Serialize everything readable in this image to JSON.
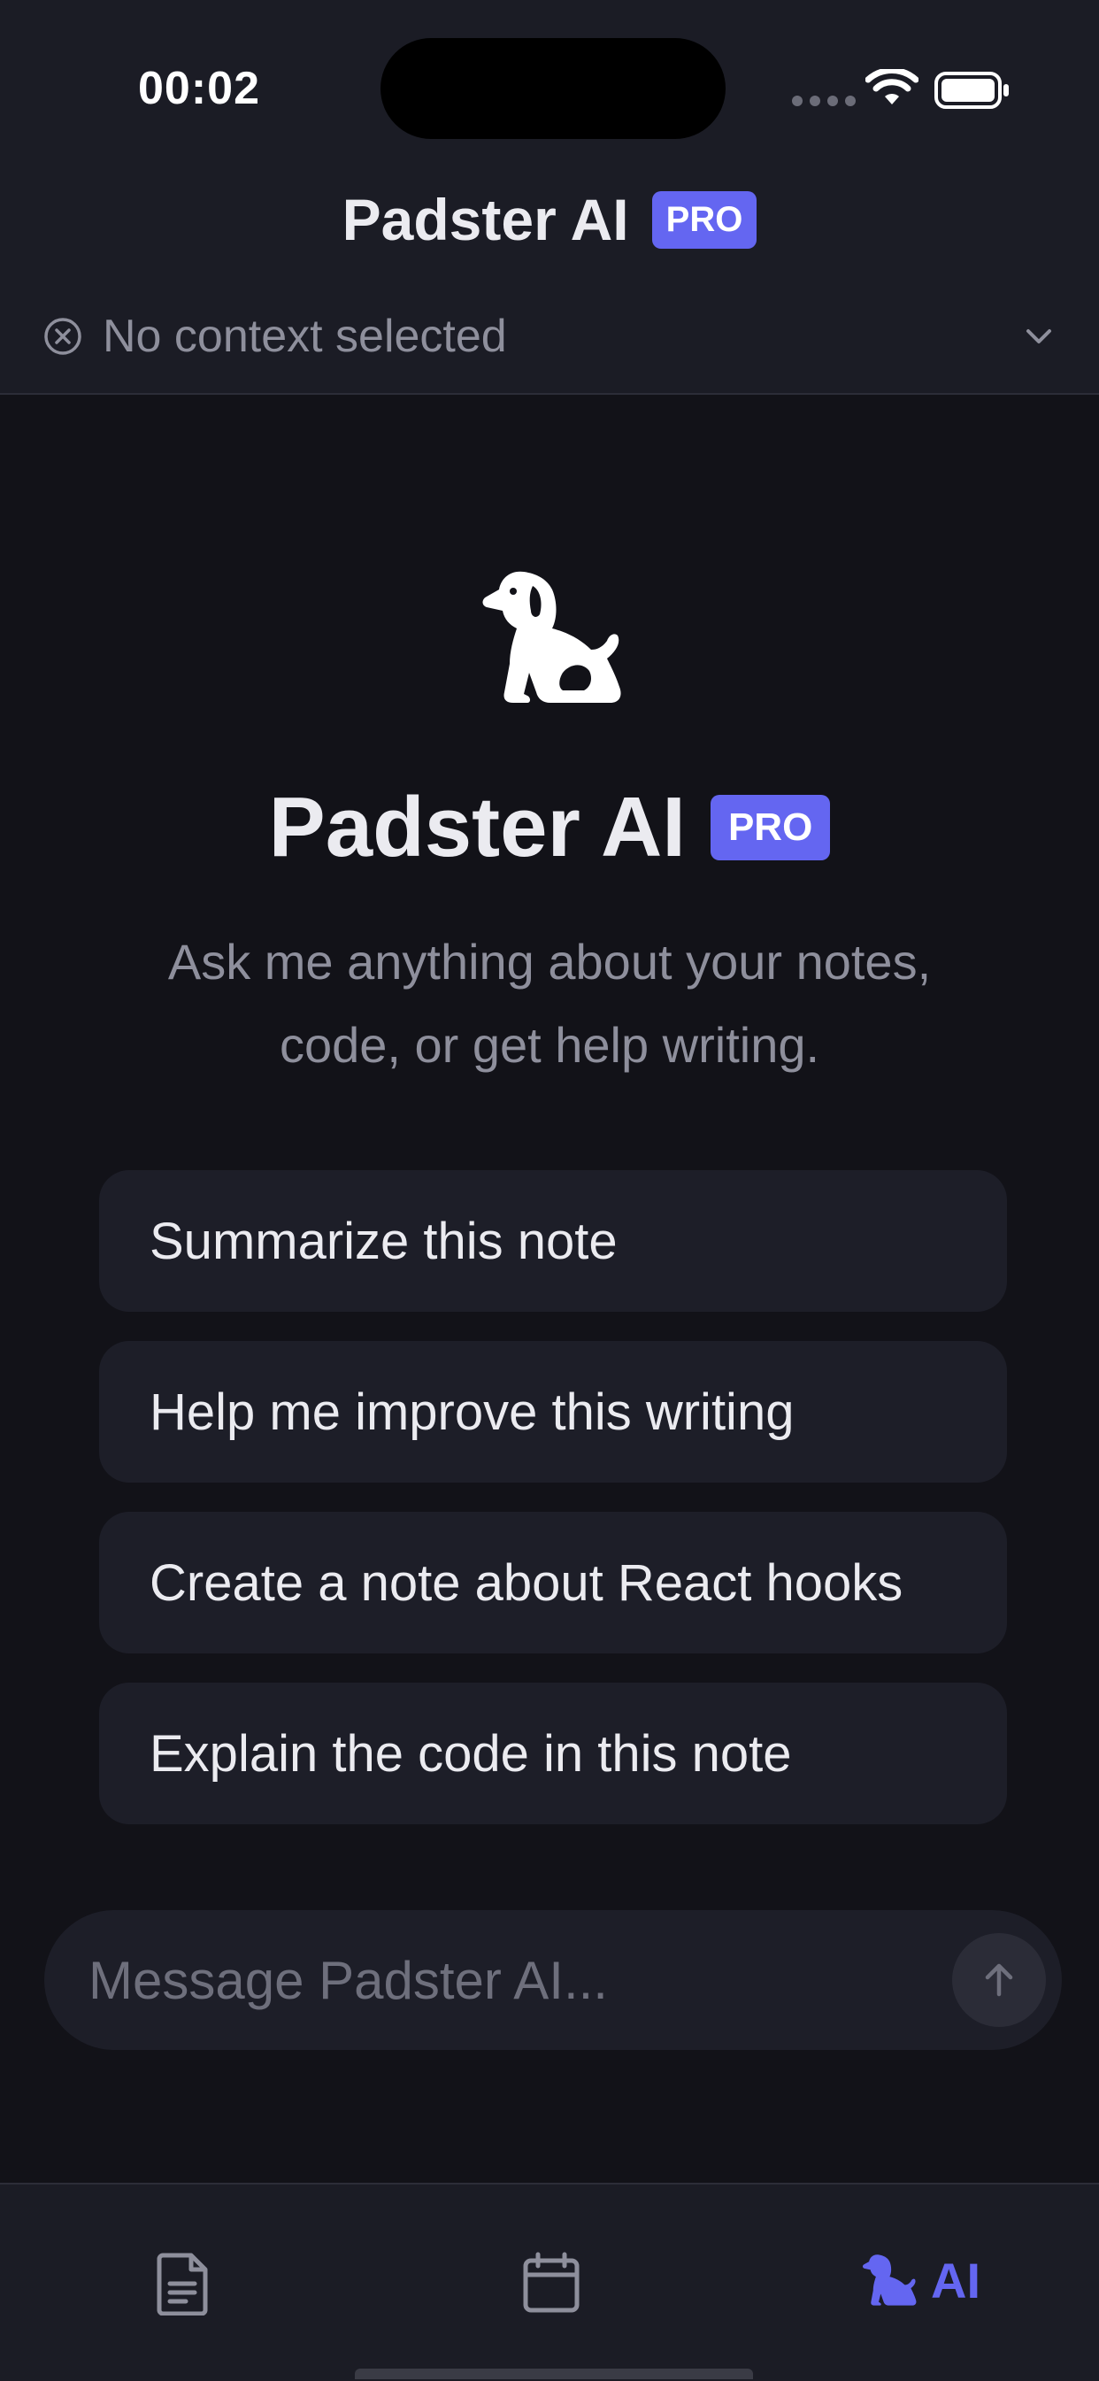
{
  "status_bar": {
    "time": "00:02"
  },
  "header": {
    "title": "Padster AI",
    "badge": "PRO",
    "context": {
      "label": "No context selected",
      "icon": "x-circle-icon",
      "dropdown_icon": "chevron-down-icon"
    }
  },
  "hero": {
    "icon": "dog-icon",
    "title": "Padster AI",
    "badge": "PRO",
    "subtitle": "Ask me anything about your notes, code, or get help writing."
  },
  "suggestions": [
    {
      "label": "Summarize this note"
    },
    {
      "label": "Help me improve this writing"
    },
    {
      "label": "Create a note about React hooks"
    },
    {
      "label": "Explain the code in this note"
    }
  ],
  "composer": {
    "placeholder": "Message Padster AI...",
    "value": "",
    "send_icon": "arrow-up-icon"
  },
  "tab_bar": {
    "tabs": [
      {
        "icon": "document-icon",
        "label": ""
      },
      {
        "icon": "calendar-icon",
        "label": ""
      },
      {
        "icon": "dog-icon",
        "label": "AI",
        "active": true
      }
    ]
  },
  "colors": {
    "background": "#121218",
    "surface": "#1b1c25",
    "card": "#1d1e28",
    "accent": "#6466f1",
    "text_primary": "#ebebf0",
    "text_secondary": "#8e8f9c"
  }
}
